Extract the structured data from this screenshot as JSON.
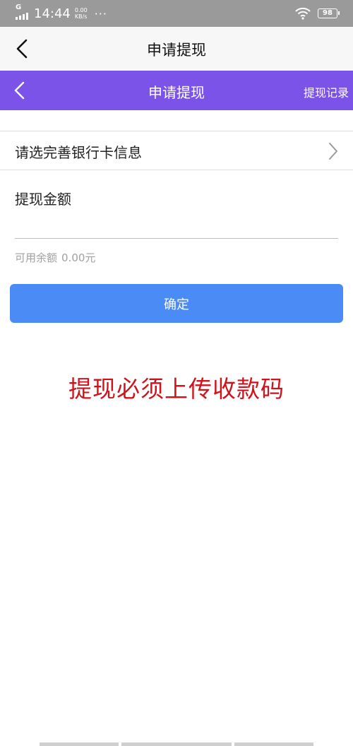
{
  "status_bar": {
    "network_type": "G",
    "time": "14:44",
    "speed_value": "0.00",
    "speed_unit": "KB/s",
    "more": "···",
    "battery_level": "98"
  },
  "outer_nav": {
    "back_icon": "chevron-left-icon",
    "title": "申请提现"
  },
  "web_nav": {
    "background": "#7b53e9",
    "back_icon": "chevron-left-icon",
    "title": "申请提现",
    "history_link": "提现记录"
  },
  "bank_card": {
    "label": "请选完善银行卡信息",
    "chevron_icon": "chevron-right-icon"
  },
  "amount": {
    "label": "提现金额",
    "value": "",
    "placeholder": ""
  },
  "balance": {
    "label": "可用余额",
    "value": "0.00元"
  },
  "confirm_button": {
    "label": "确定",
    "color": "#4a8bf6"
  },
  "notice": {
    "text": "提现必须上传收款码",
    "color": "#d0121b"
  }
}
